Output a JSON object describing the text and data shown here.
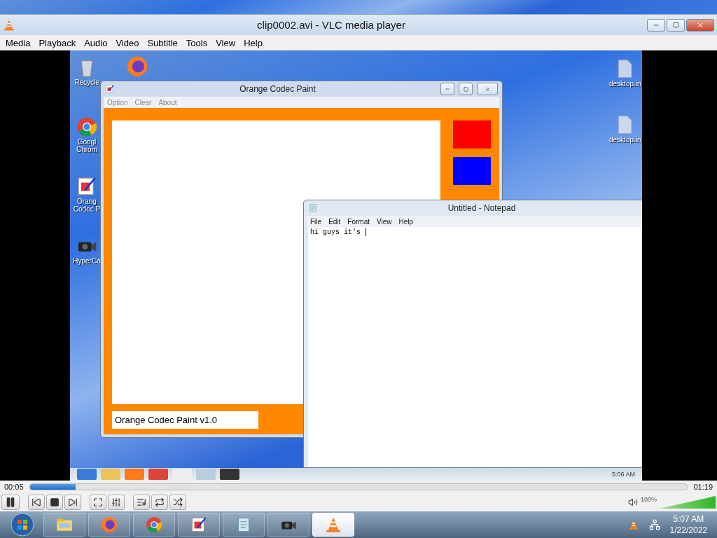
{
  "window": {
    "title": "clip0002.avi - VLC media player"
  },
  "menu": [
    "Media",
    "Playback",
    "Audio",
    "Video",
    "Subtitle",
    "Tools",
    "View",
    "Help"
  ],
  "video_frame": {
    "desktop_icons": [
      {
        "label": "Recycle",
        "kind": "bin"
      },
      {
        "label": "Googl Chrom",
        "kind": "chrome"
      },
      {
        "label": "Orang Codec P",
        "kind": "paint"
      },
      {
        "label": "HyperCa",
        "kind": "camera"
      }
    ],
    "right_icons": [
      {
        "label": "desktop.in"
      },
      {
        "label": "desktop.in"
      }
    ],
    "paint_window": {
      "title": "Orange Codec Paint",
      "menu": [
        "Option",
        "Clear",
        "About"
      ],
      "swatches": [
        {
          "color": "#ff0000"
        },
        {
          "color": "#0000ff"
        }
      ],
      "status": "Orange Codec Paint v1.0"
    },
    "notepad": {
      "title": "Untitled - Notepad",
      "menu": [
        "File",
        "Edit",
        "Format",
        "View",
        "Help"
      ],
      "text": "hi guys it's "
    },
    "taskbar": {
      "time": "5:06 AM"
    }
  },
  "playback": {
    "elapsed": "00:05",
    "total": "01:19",
    "level": 0.07
  },
  "controls": [
    {
      "kind": "pause"
    },
    {
      "kind": "previous"
    },
    {
      "kind": "stop"
    },
    {
      "kind": "next"
    },
    {
      "kind": "fullscreen"
    },
    {
      "kind": "settings"
    },
    {
      "kind": "playlist"
    },
    {
      "kind": "loop"
    },
    {
      "kind": "random"
    }
  ],
  "volume": {
    "reading": "100%",
    "level": 1
  },
  "taskbar": {
    "apps": [
      {
        "kind": "explorer",
        "selected": false
      },
      {
        "kind": "firefox",
        "selected": false
      },
      {
        "kind": "chrome",
        "selected": false
      },
      {
        "kind": "paint",
        "selected": false
      },
      {
        "kind": "notepad",
        "selected": false
      },
      {
        "kind": "camera",
        "selected": false
      },
      {
        "kind": "vlc",
        "selected": true
      }
    ],
    "time": "5:07 AM",
    "date": "1/22/2022"
  }
}
